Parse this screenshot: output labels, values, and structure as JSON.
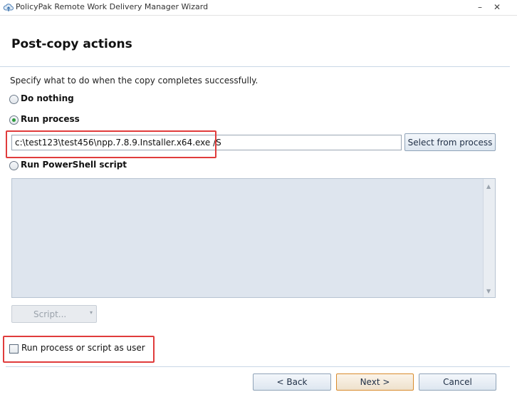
{
  "window": {
    "title": "PolicyPak Remote Work Delivery Manager Wizard",
    "minimize_glyph": "–",
    "close_glyph": "✕",
    "app_icon": "cloud-upload-icon"
  },
  "page": {
    "title": "Post-copy actions",
    "description": "Specify what to do when the copy completes successfully."
  },
  "options": {
    "do_nothing": {
      "label": "Do nothing",
      "selected": false
    },
    "run_process": {
      "label": "Run process",
      "selected": true
    },
    "run_powershell": {
      "label": "Run PowerShell script",
      "selected": false
    }
  },
  "process": {
    "command_value": "c:\\test123\\test456\\npp.7.8.9.Installer.x64.exe /S",
    "select_from_process_label": "Select from process"
  },
  "script": {
    "editor_value": "",
    "script_button_label": "Script...",
    "script_button_enabled": false,
    "dropdown_glyph": "▾",
    "scroll_up_glyph": "▲",
    "scroll_down_glyph": "▼"
  },
  "run_as_user": {
    "label": "Run process or script as user",
    "checked": false
  },
  "footer": {
    "back_label": "< Back",
    "next_label": "Next >",
    "cancel_label": "Cancel"
  },
  "colors": {
    "highlight": "#e03c3c",
    "radio_checked": "#2d9c3c",
    "script_area_bg": "#dee5ee",
    "next_border": "#d98b2b"
  }
}
